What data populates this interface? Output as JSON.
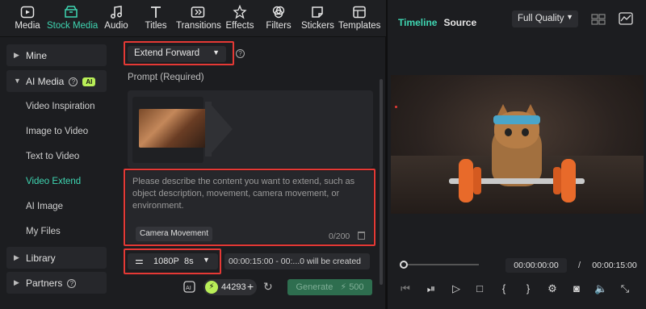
{
  "toolbar": {
    "items": [
      {
        "label": "Media",
        "icon": "media-icon"
      },
      {
        "label": "Stock Media",
        "icon": "stock-media-icon",
        "active": true
      },
      {
        "label": "Audio",
        "icon": "audio-icon"
      },
      {
        "label": "Titles",
        "icon": "titles-icon"
      },
      {
        "label": "Transitions",
        "icon": "transitions-icon"
      },
      {
        "label": "Effects",
        "icon": "effects-icon"
      },
      {
        "label": "Filters",
        "icon": "filters-icon"
      },
      {
        "label": "Stickers",
        "icon": "stickers-icon"
      },
      {
        "label": "Templates",
        "icon": "templates-icon"
      }
    ]
  },
  "sidebar": {
    "mine": "Mine",
    "ai_media": "AI Media",
    "ai_badge": "AI",
    "items": [
      {
        "label": "Video Inspiration"
      },
      {
        "label": "Image to Video"
      },
      {
        "label": "Text to Video"
      },
      {
        "label": "Video Extend",
        "active": true
      },
      {
        "label": "AI Image"
      },
      {
        "label": "My Files"
      }
    ],
    "library": "Library",
    "partners": "Partners"
  },
  "content": {
    "mode_select": "Extend Forward",
    "prompt_label": "Prompt (Required)",
    "prompt_placeholder": "Please describe the content you want to extend, such as object description, movement, camera movement, or environment.",
    "camera_movement_button": "Camera Movement",
    "char_counter": "0/200",
    "resolution": "1080P",
    "duration": "8s",
    "time_info": "00:00:15:00 - 00:...0 will be created",
    "credits": "44293",
    "generate_label": "Generate",
    "generate_cost": "500"
  },
  "preview": {
    "tab_timeline": "Timeline",
    "tab_source": "Source",
    "quality": "Full Quality",
    "current_time": "00:00:00:00",
    "separator": "/",
    "total_time": "00:00:15:00"
  },
  "colors": {
    "accent": "#3fd6b2",
    "highlight_box": "#e53935",
    "ai_badge": "#b9ef58"
  }
}
